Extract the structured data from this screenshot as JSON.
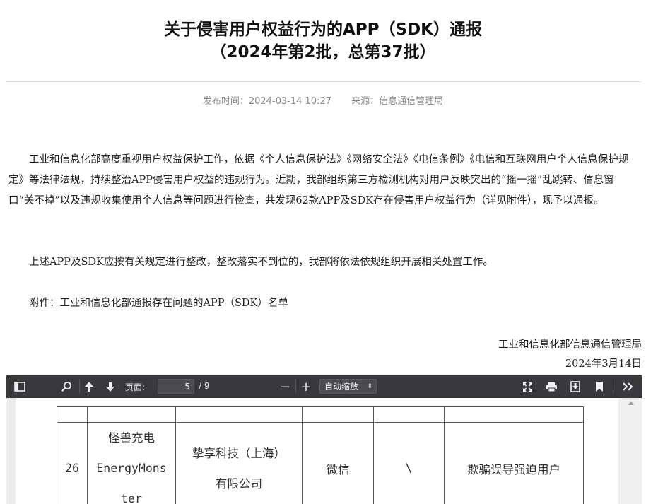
{
  "article": {
    "title_line1": "关于侵害用户权益行为的APP（SDK）通报",
    "title_line2": "（2024年第2批，总第37批）",
    "publish_label": "发布时间：2024-03-14 10:27",
    "source_label": "来源：信息通信管理局",
    "para1": "工业和信息化部高度重视用户权益保护工作，依据《个人信息保护法》《网络安全法》《电信条例》《电信和互联网用户个人信息保护规定》等法律法规，持续整治APP侵害用户权益的违规行为。近期，我部组织第三方检测机构对用户反映突出的“摇一摇”乱跳转、信息窗口“关不掉”以及违规收集使用个人信息等问题进行检查，共发现62款APP及SDK存在侵害用户权益行为（详见附件），现予以通报。",
    "para2": "上述APP及SDK应按有关规定进行整改，整改落实不到位的，我部将依法依规组织开展相关处置工作。",
    "para3": "附件：工业和信息化部通报存在问题的APP（SDK）名单",
    "signature_org": "工业和信息化部信息通信管理局",
    "signature_date": "2024年3月14日"
  },
  "pdf_viewer": {
    "page_label": "页面:",
    "current_page": "5",
    "total_pages": "/ 9",
    "zoom": "自动缩放",
    "zoom_out": "−",
    "zoom_in": "+",
    "icons": [
      "sidebar-toggle-icon",
      "search-icon",
      "arrow-up-icon",
      "arrow-down-icon",
      "fullscreen-icon",
      "print-icon",
      "download-icon",
      "bookmark-icon",
      "more-tools-icon"
    ]
  },
  "table": {
    "row": {
      "index": "26",
      "app_name_lines": [
        "怪兽充电",
        "EnergyMons",
        "ter"
      ],
      "developer_lines": [
        "挚享科技（上海）",
        "有限公司"
      ],
      "platform": "微信",
      "version": "\\",
      "issue": "欺骗误导强迫用户"
    }
  }
}
